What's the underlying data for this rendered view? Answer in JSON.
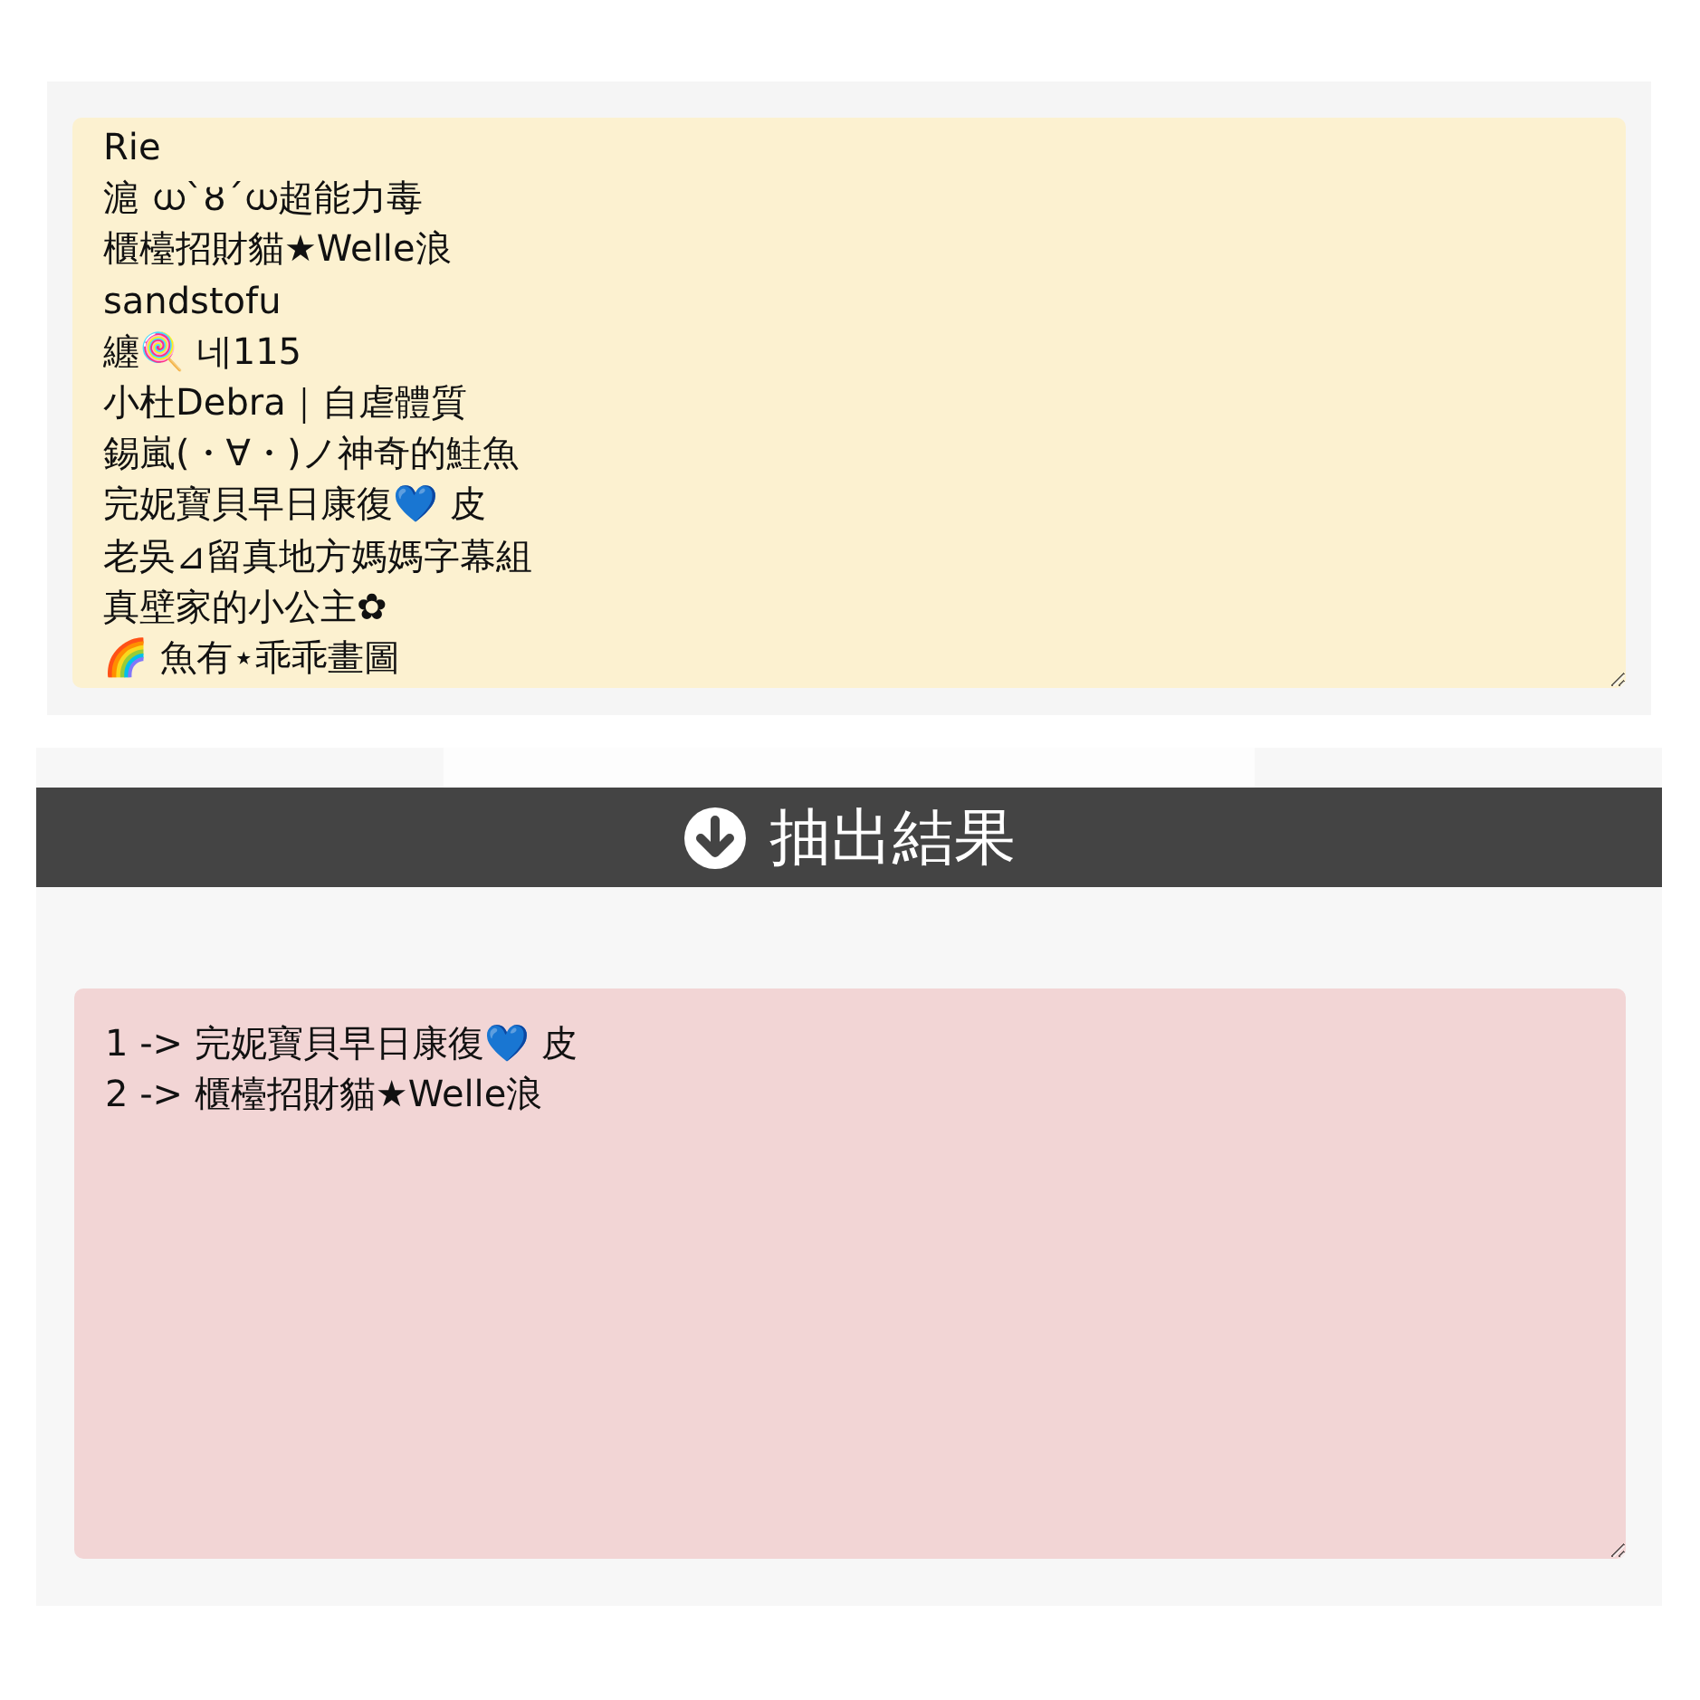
{
  "names": {
    "lines": [
      "Rie",
      "滬 ധ`ȣ´ധ超能力毒",
      "櫃檯招財貓★Welle浪",
      "sandstofu",
      "纏🍭 네115",
      "小杜Debra｜自虐體質",
      "錫嵐(・∀・)ノ神奇的鮭魚",
      "完妮寶貝早日康復💙 皮",
      "老吳⊿留真地方媽媽字幕組",
      "真壁家的小公主✿",
      "🌈 魚有⋆乖乖畫圖"
    ]
  },
  "draw_button": {
    "label": "抽出結果"
  },
  "results": {
    "lines": [
      "1 -> 完妮寶貝早日康復💙 皮",
      "2 -> 櫃檯招財貓★Welle浪"
    ]
  }
}
